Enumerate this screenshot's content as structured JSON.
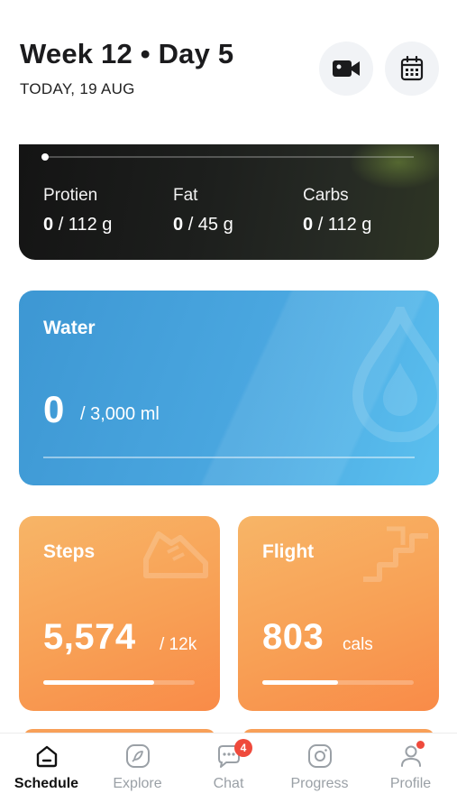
{
  "header": {
    "title": "Week 12 • Day 5",
    "date": "TODAY, 19 AUG",
    "video_icon": "video-camera-icon",
    "calendar_icon": "calendar-icon"
  },
  "macros": {
    "items": [
      {
        "label": "Protien",
        "current": "0",
        "goal": "/ 112 g"
      },
      {
        "label": "Fat",
        "current": "0",
        "goal": "/ 45 g"
      },
      {
        "label": "Carbs",
        "current": "0",
        "goal": "/ 112 g"
      }
    ]
  },
  "water": {
    "label": "Water",
    "current": "0",
    "goal": "/ 3,000 ml",
    "icon": "water-drop-icon"
  },
  "steps": {
    "label": "Steps",
    "value": "5,574",
    "unit": "/ 12k",
    "progress": 0.73,
    "icon": "shoe-icon"
  },
  "flight": {
    "label": "Flight",
    "value": "803",
    "unit": "cals",
    "progress": 0.5,
    "icon": "stairs-icon"
  },
  "nav": {
    "items": [
      {
        "label": "Schedule",
        "icon": "home-icon",
        "active": true
      },
      {
        "label": "Explore",
        "icon": "compass-icon",
        "active": false
      },
      {
        "label": "Chat",
        "icon": "chat-icon",
        "active": false
      },
      {
        "label": "Progress",
        "icon": "camera-icon",
        "active": false
      },
      {
        "label": "Profile",
        "icon": "profile-icon",
        "active": false
      }
    ],
    "chat_badge": "4"
  },
  "colors": {
    "water": "#4aa7e0",
    "orange": "#f8a055",
    "badge": "#ef4a3c"
  }
}
